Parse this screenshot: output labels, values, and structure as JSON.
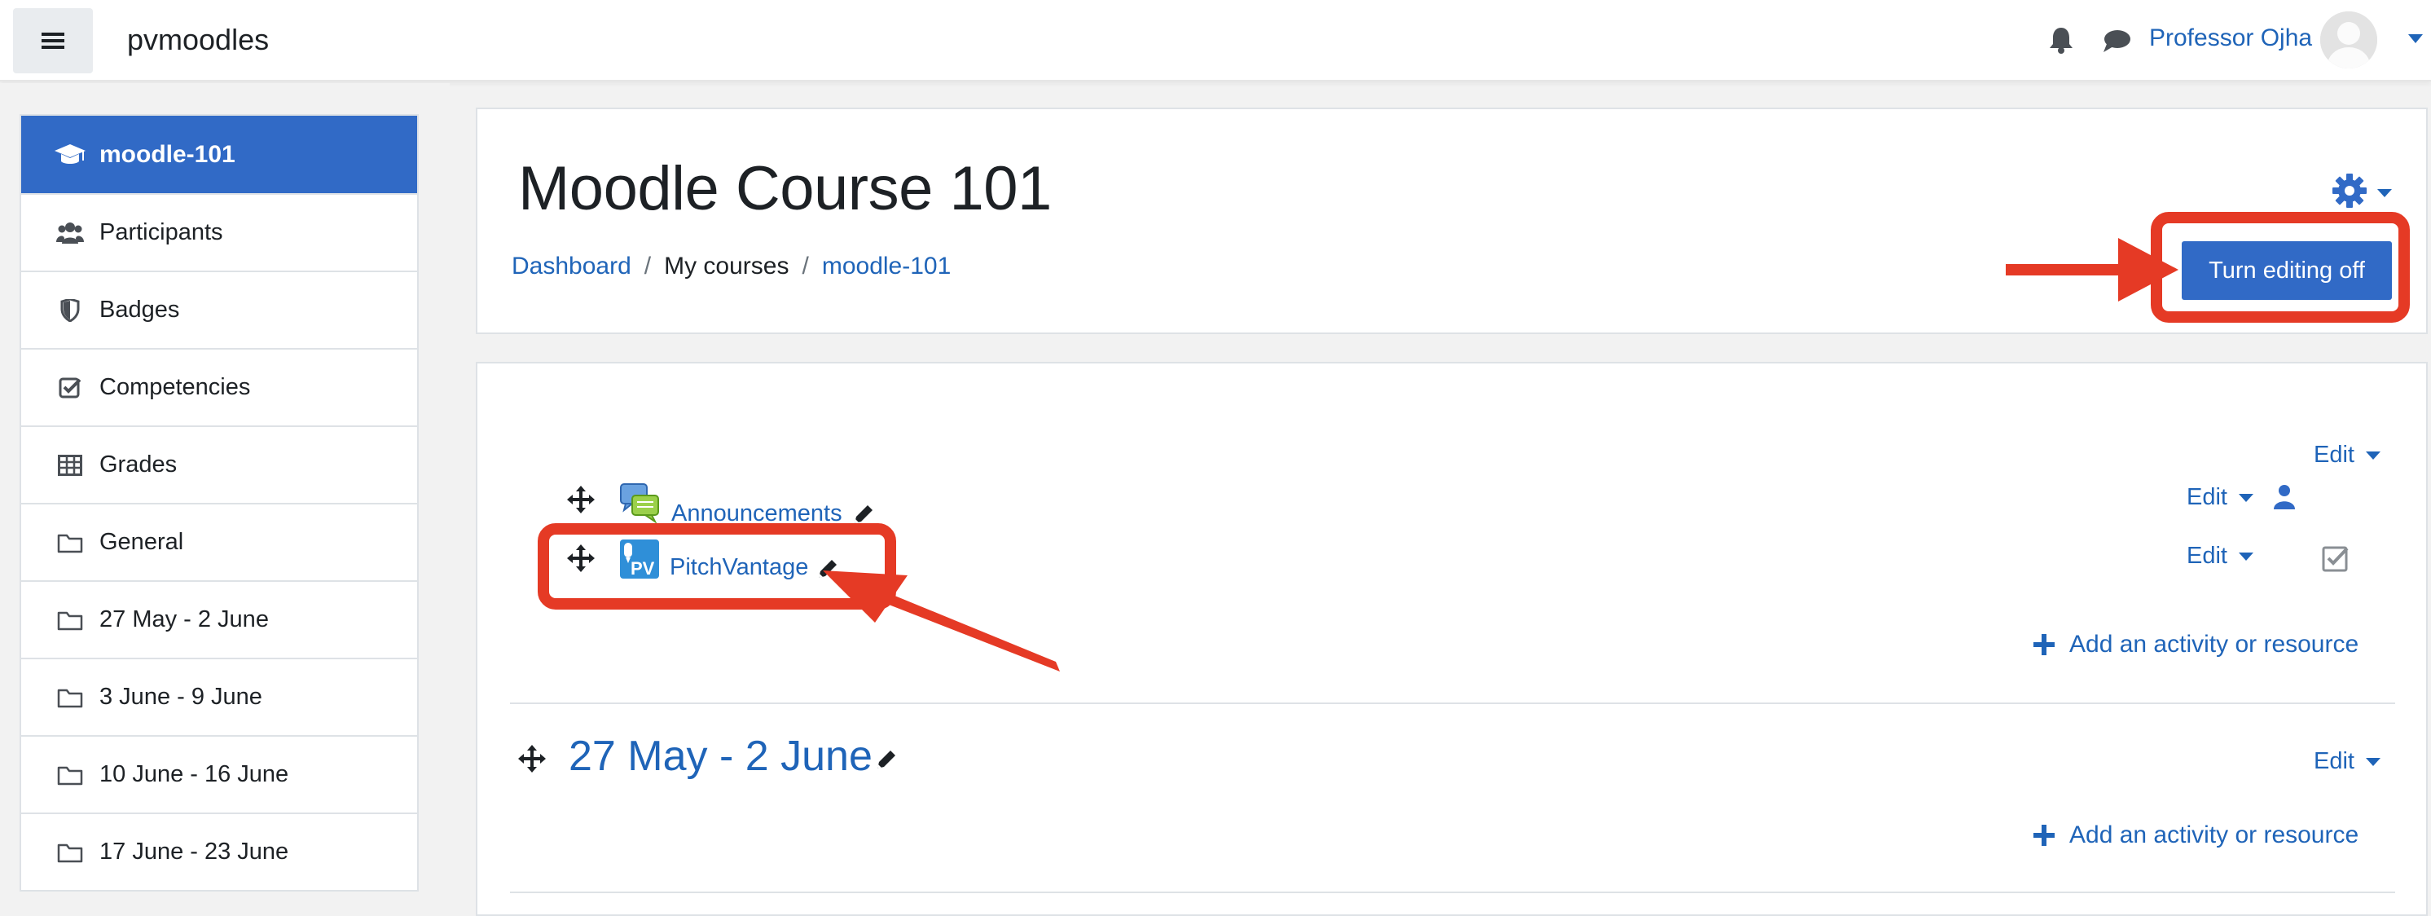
{
  "navbar": {
    "site_name": "pvmoodles",
    "user_name": "Professor Ojha"
  },
  "sidebar": {
    "items": [
      {
        "label": "moodle-101",
        "icon": "graduation-cap-icon"
      },
      {
        "label": "Participants",
        "icon": "users-icon"
      },
      {
        "label": "Badges",
        "icon": "shield-icon"
      },
      {
        "label": "Competencies",
        "icon": "checkbox-icon"
      },
      {
        "label": "Grades",
        "icon": "table-icon"
      },
      {
        "label": "General",
        "icon": "folder-icon"
      },
      {
        "label": "27 May - 2 June",
        "icon": "folder-icon"
      },
      {
        "label": "3 June - 9 June",
        "icon": "folder-icon"
      },
      {
        "label": "10 June - 16 June",
        "icon": "folder-icon"
      },
      {
        "label": "17 June - 23 June",
        "icon": "folder-icon"
      }
    ]
  },
  "header": {
    "title": "Moodle Course 101",
    "breadcrumb": [
      "Dashboard",
      "My courses",
      "moodle-101"
    ],
    "breadcrumb_separator": "/",
    "edit_toggle_label": "Turn editing off"
  },
  "content": {
    "edit_label": "Edit",
    "add_activity_label": "Add an activity or resource",
    "activities": [
      {
        "name": "Announcements",
        "icon": "forum-icon"
      },
      {
        "name": "PitchVantage",
        "icon": "pitchvantage-icon"
      }
    ],
    "sections": [
      {
        "title": "27 May - 2 June"
      }
    ]
  },
  "colors": {
    "accent": "#316ac6",
    "link": "#1f64b8",
    "annotation": "#e53a25"
  }
}
